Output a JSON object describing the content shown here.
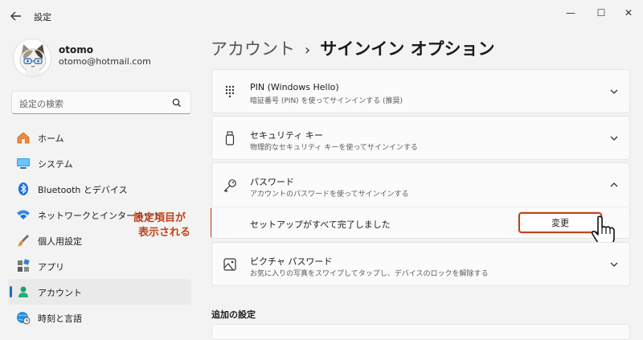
{
  "window": {
    "app_title": "設定",
    "controls": {
      "minimize": "—",
      "maximize": "☐",
      "close": "✕"
    }
  },
  "profile": {
    "name": "otomo",
    "email": "otomo@hotmail.com"
  },
  "search": {
    "placeholder": "設定の検索"
  },
  "sidebar": {
    "items": [
      {
        "label": "ホーム",
        "icon": "home-icon"
      },
      {
        "label": "システム",
        "icon": "system-icon"
      },
      {
        "label": "Bluetooth とデバイス",
        "icon": "bluetooth-icon"
      },
      {
        "label": "ネットワークとインターネット",
        "icon": "network-icon"
      },
      {
        "label": "個人用設定",
        "icon": "brush-icon"
      },
      {
        "label": "アプリ",
        "icon": "apps-icon"
      },
      {
        "label": "アカウント",
        "icon": "account-icon",
        "active": true
      },
      {
        "label": "時刻と言語",
        "icon": "globe-clock-icon"
      }
    ]
  },
  "annotation": {
    "line1": "設定項目が",
    "line2": "表示される",
    "color": "#c0441a"
  },
  "breadcrumb": {
    "parent": "アカウント",
    "separator": "›",
    "current": "サインイン オプション"
  },
  "options": [
    {
      "title": "PIN (Windows Hello)",
      "desc": "暗証番号 (PIN) を使ってサインインする (推奨)",
      "icon": "keypad-icon",
      "expanded": false
    },
    {
      "title": "セキュリティ キー",
      "desc": "物理的なセキュリティ キーを使ってサインインする",
      "icon": "usb-key-icon",
      "expanded": false
    },
    {
      "title": "パスワード",
      "desc": "アカウントのパスワードを使ってサインインする",
      "icon": "key-icon",
      "expanded": true
    },
    {
      "title": "ピクチャ パスワード",
      "desc": "お気に入りの写真をスワイプしてタップし、デバイスのロックを解除する",
      "icon": "picture-icon",
      "expanded": false
    }
  ],
  "password_panel": {
    "status": "セットアップがすべて完了しました",
    "change_label": "変更"
  },
  "additional": {
    "title": "追加の設定"
  },
  "colors": {
    "accent": "#1a6dc0",
    "highlight": "#c0441a",
    "background": "#f3f3f3",
    "card": "#fbfbfb"
  }
}
